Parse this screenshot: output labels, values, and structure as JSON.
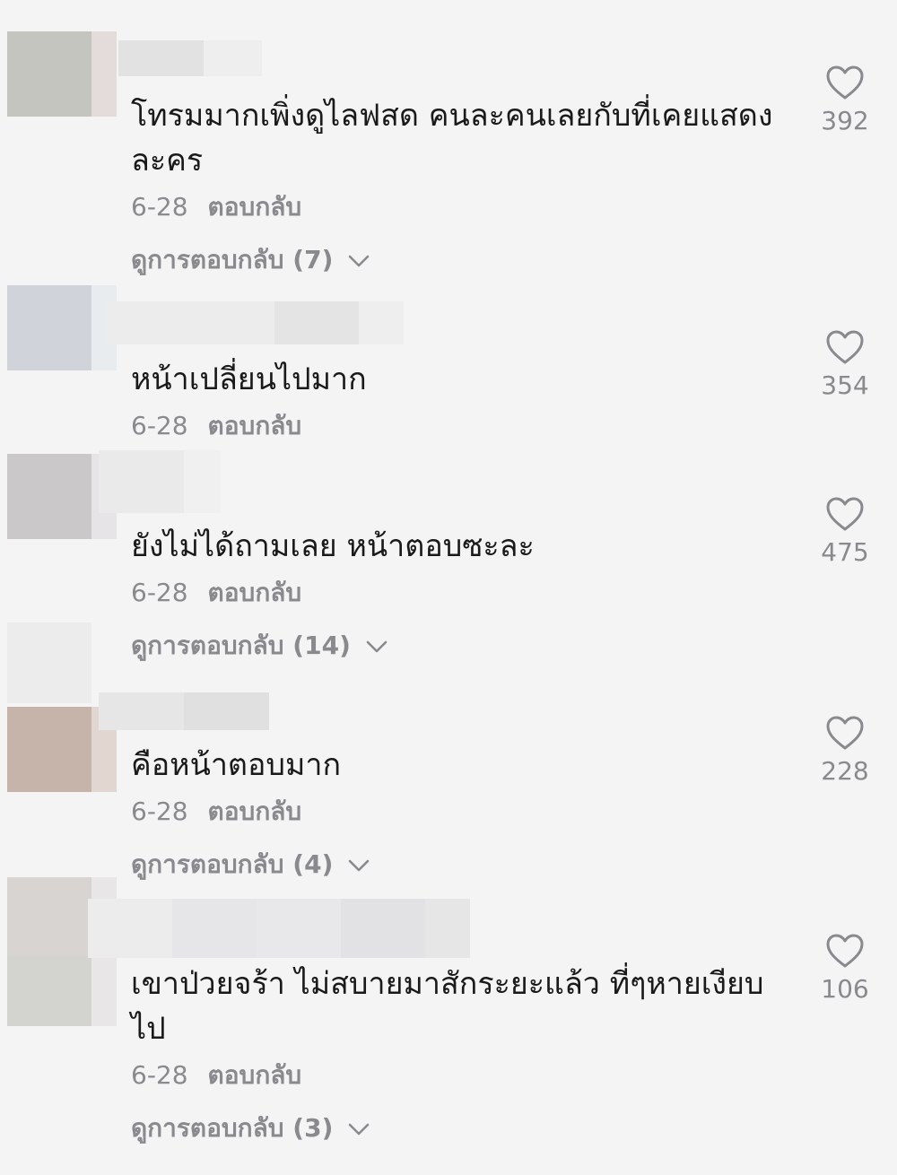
{
  "comments": [
    {
      "text": "โทรมมากเพิ่งดูไลฟสด คนละคนเลยกับที่เคยแสดงละคร",
      "date": "6-28",
      "reply_label": "ตอบกลับ",
      "view_replies": "ดูการตอบกลับ (7)",
      "likes": "392"
    },
    {
      "text": "หน้าเปลี่ยนไปมาก",
      "date": "6-28",
      "reply_label": "ตอบกลับ",
      "likes": "354"
    },
    {
      "text": "ยังไม่ได้ถามเลย หน้าตอบซะละ",
      "date": "6-28",
      "reply_label": "ตอบกลับ",
      "view_replies": "ดูการตอบกลับ (14)",
      "likes": "475"
    },
    {
      "text": "คือหน้าตอบมาก",
      "date": "6-28",
      "reply_label": "ตอบกลับ",
      "view_replies": "ดูการตอบกลับ (4)",
      "likes": "228"
    },
    {
      "text": "เขาป่วยจร้า ไม่สบายมาสักระยะแล้ว ที่ๆหายเงียบไป",
      "date": "6-28",
      "reply_label": "ตอบกลับ",
      "view_replies": "ดูการตอบกลับ (3)",
      "likes": "106"
    }
  ],
  "colors": {
    "background": "#f4f4f5",
    "text": "#1a1a1a",
    "secondary_text": "#8a8a8e",
    "heart_outline": "#8a8a8e"
  },
  "icons": {
    "like": "heart-outline-icon",
    "expand": "chevron-down-icon"
  }
}
